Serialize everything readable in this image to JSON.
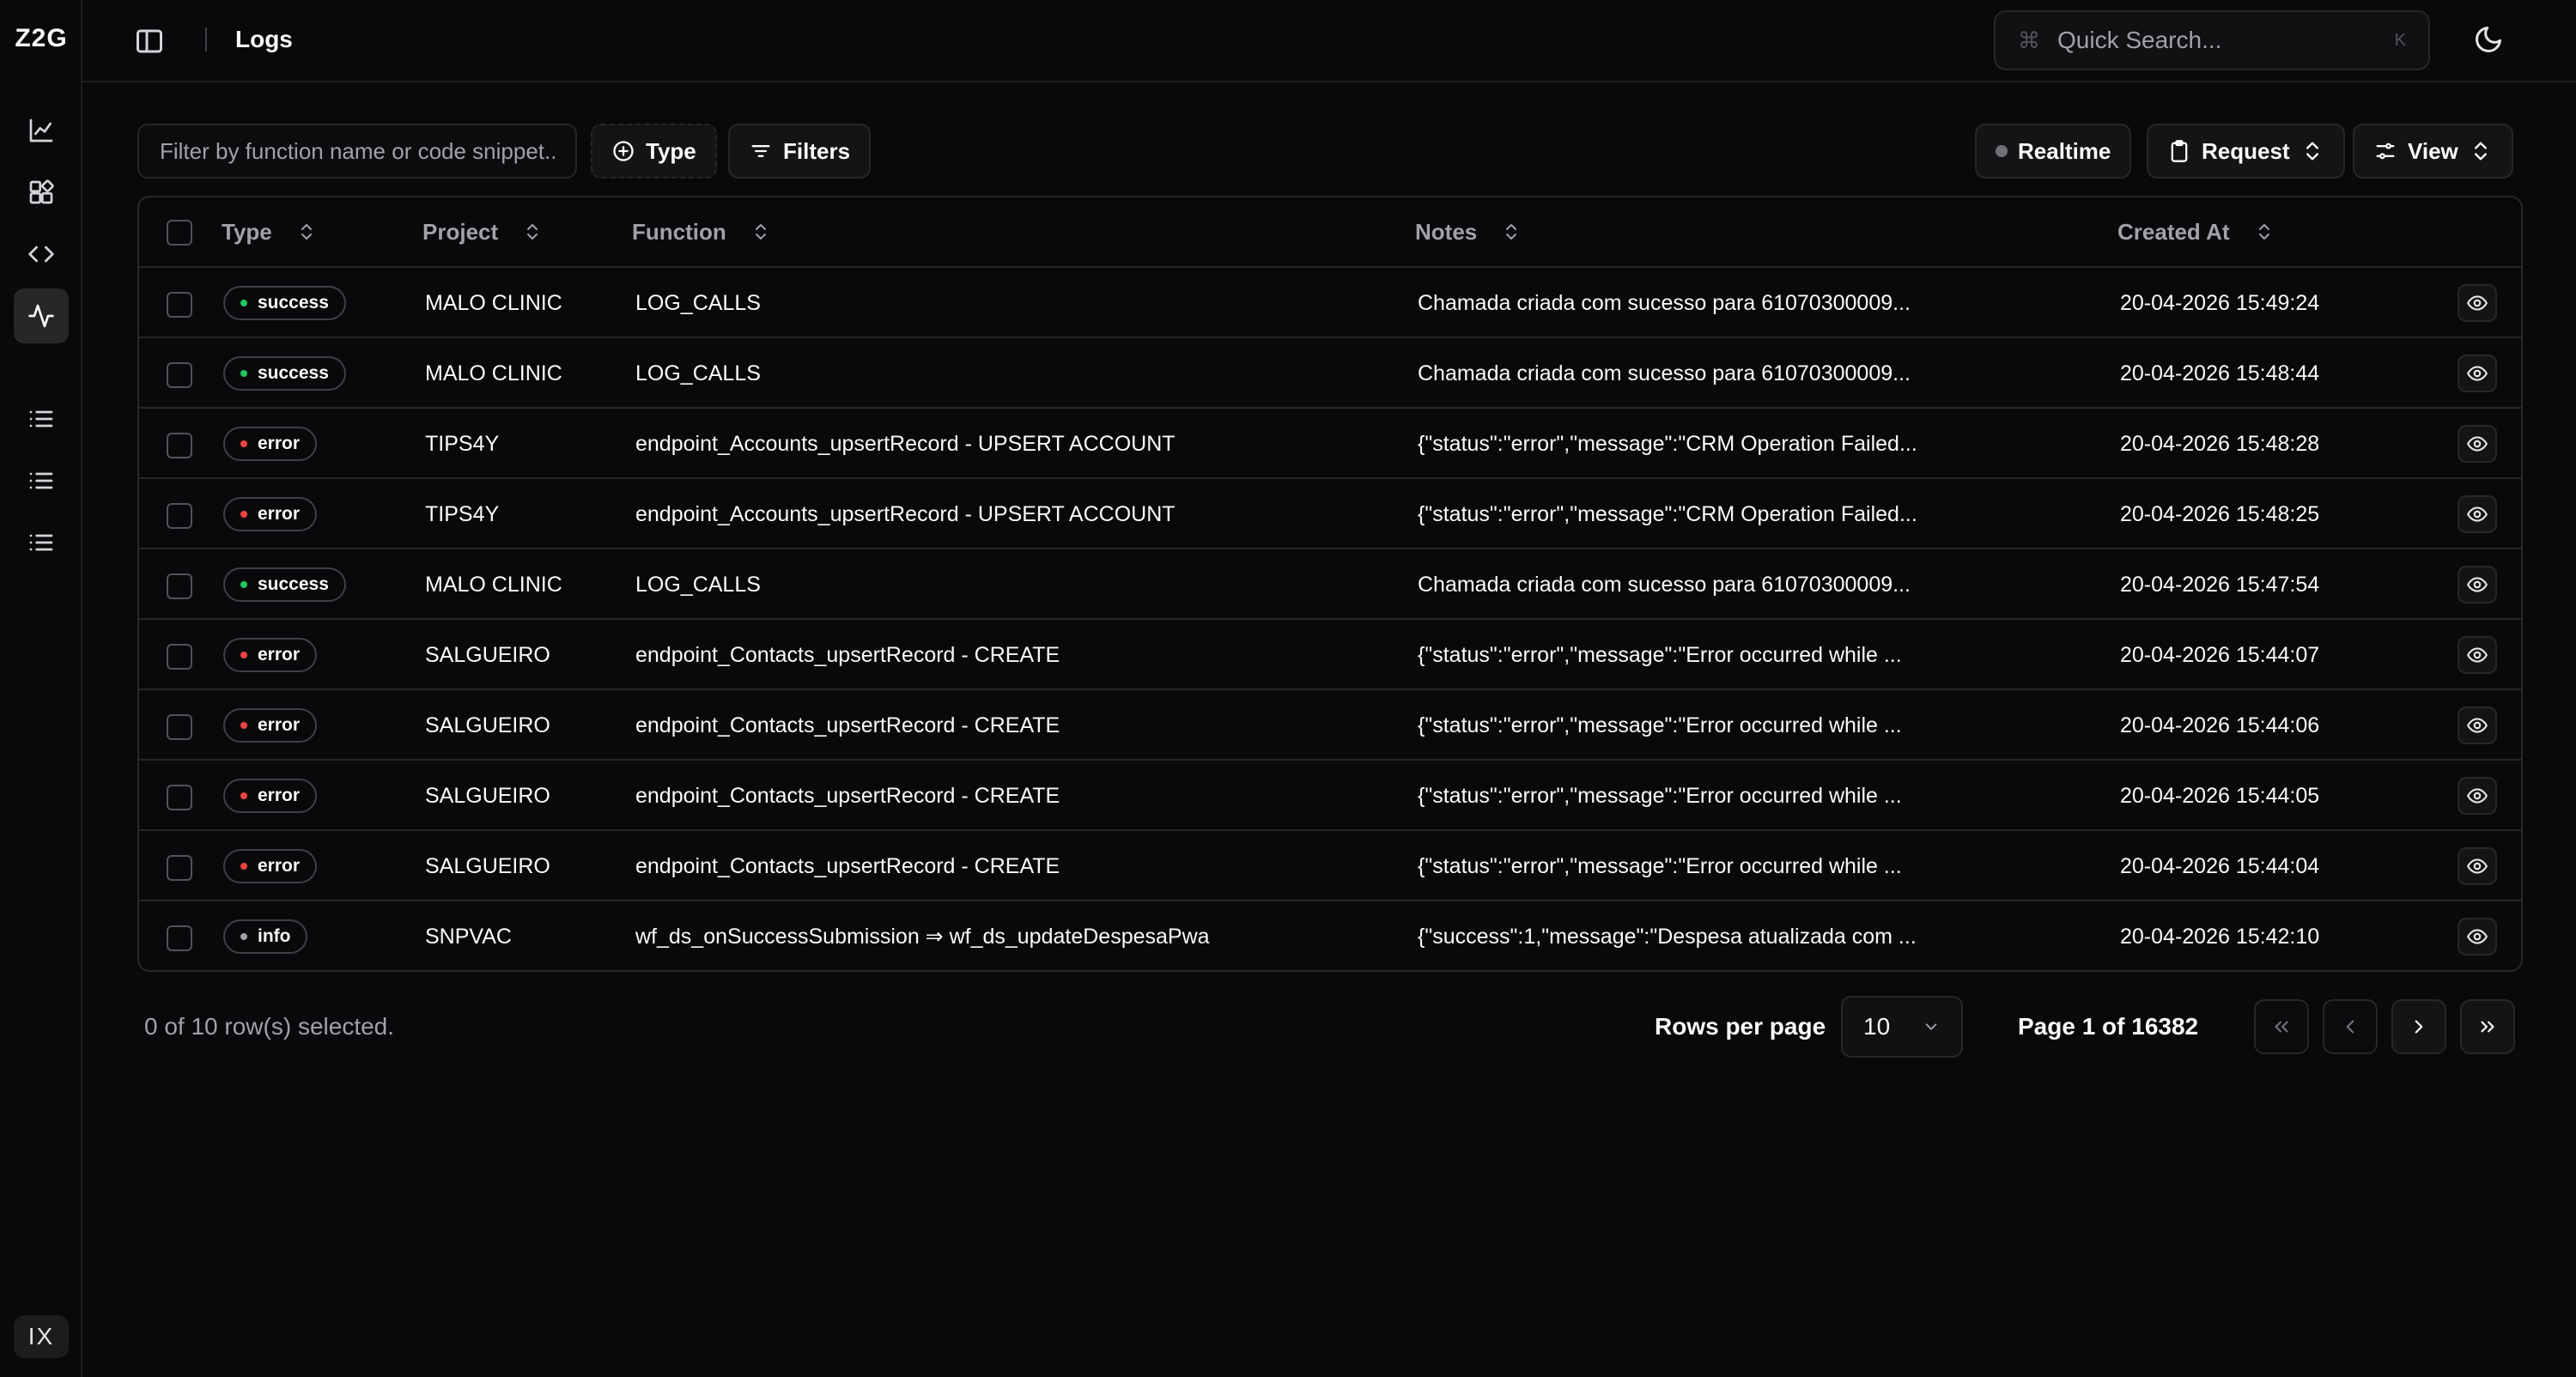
{
  "brand": {
    "logo": "Z2G"
  },
  "sidebar": {
    "icons": [
      "chart-icon",
      "blocks-icon",
      "code-icon",
      "activity-icon",
      "list-icon",
      "list-icon",
      "list-icon"
    ],
    "active_index": 3,
    "bottom_label": "IX"
  },
  "header": {
    "title": "Logs",
    "search_placeholder": "Quick Search...",
    "search_cmd": "⌘",
    "search_shortcut": "K"
  },
  "toolbar": {
    "filter_placeholder": "Filter by function name or code snippet...",
    "type_label": "Type",
    "filters_label": "Filters",
    "realtime_label": "Realtime",
    "request_label": "Request",
    "view_label": "View"
  },
  "table": {
    "columns": [
      "Type",
      "Project",
      "Function",
      "Notes",
      "Created At"
    ],
    "rows": [
      {
        "type": "success",
        "project": "MALO CLINIC",
        "function": "LOG_CALLS",
        "notes": "Chamada criada com sucesso para 61070300009...",
        "created": "20-04-2026 15:49:24"
      },
      {
        "type": "success",
        "project": "MALO CLINIC",
        "function": "LOG_CALLS",
        "notes": "Chamada criada com sucesso para 61070300009...",
        "created": "20-04-2026 15:48:44"
      },
      {
        "type": "error",
        "project": "TIPS4Y",
        "function": "endpoint_Accounts_upsertRecord - UPSERT ACCOUNT",
        "notes": "{\"status\":\"error\",\"message\":\"CRM Operation Failed...",
        "created": "20-04-2026 15:48:28"
      },
      {
        "type": "error",
        "project": "TIPS4Y",
        "function": "endpoint_Accounts_upsertRecord - UPSERT ACCOUNT",
        "notes": "{\"status\":\"error\",\"message\":\"CRM Operation Failed...",
        "created": "20-04-2026 15:48:25"
      },
      {
        "type": "success",
        "project": "MALO CLINIC",
        "function": "LOG_CALLS",
        "notes": "Chamada criada com sucesso para 61070300009...",
        "created": "20-04-2026 15:47:54"
      },
      {
        "type": "error",
        "project": "SALGUEIRO",
        "function": "endpoint_Contacts_upsertRecord - CREATE",
        "notes": "{\"status\":\"error\",\"message\":\"Error occurred while ...",
        "created": "20-04-2026 15:44:07"
      },
      {
        "type": "error",
        "project": "SALGUEIRO",
        "function": "endpoint_Contacts_upsertRecord - CREATE",
        "notes": "{\"status\":\"error\",\"message\":\"Error occurred while ...",
        "created": "20-04-2026 15:44:06"
      },
      {
        "type": "error",
        "project": "SALGUEIRO",
        "function": "endpoint_Contacts_upsertRecord - CREATE",
        "notes": "{\"status\":\"error\",\"message\":\"Error occurred while ...",
        "created": "20-04-2026 15:44:05"
      },
      {
        "type": "error",
        "project": "SALGUEIRO",
        "function": "endpoint_Contacts_upsertRecord - CREATE",
        "notes": "{\"status\":\"error\",\"message\":\"Error occurred while ...",
        "created": "20-04-2026 15:44:04"
      },
      {
        "type": "info",
        "project": "SNPVAC",
        "function": "wf_ds_onSuccessSubmission ⇒ wf_ds_updateDespesaPwa",
        "notes": "{\"success\":1,\"message\":\"Despesa atualizada com ...",
        "created": "20-04-2026 15:42:10"
      }
    ]
  },
  "status_colors": {
    "success": "#22c55e",
    "error": "#ef4444",
    "info": "#a1a1aa"
  },
  "footer": {
    "selected_text": "0 of 10 row(s) selected.",
    "rows_per_page_label": "Rows per page",
    "rows_per_page_value": "10",
    "page_text": "Page 1 of 16382"
  }
}
